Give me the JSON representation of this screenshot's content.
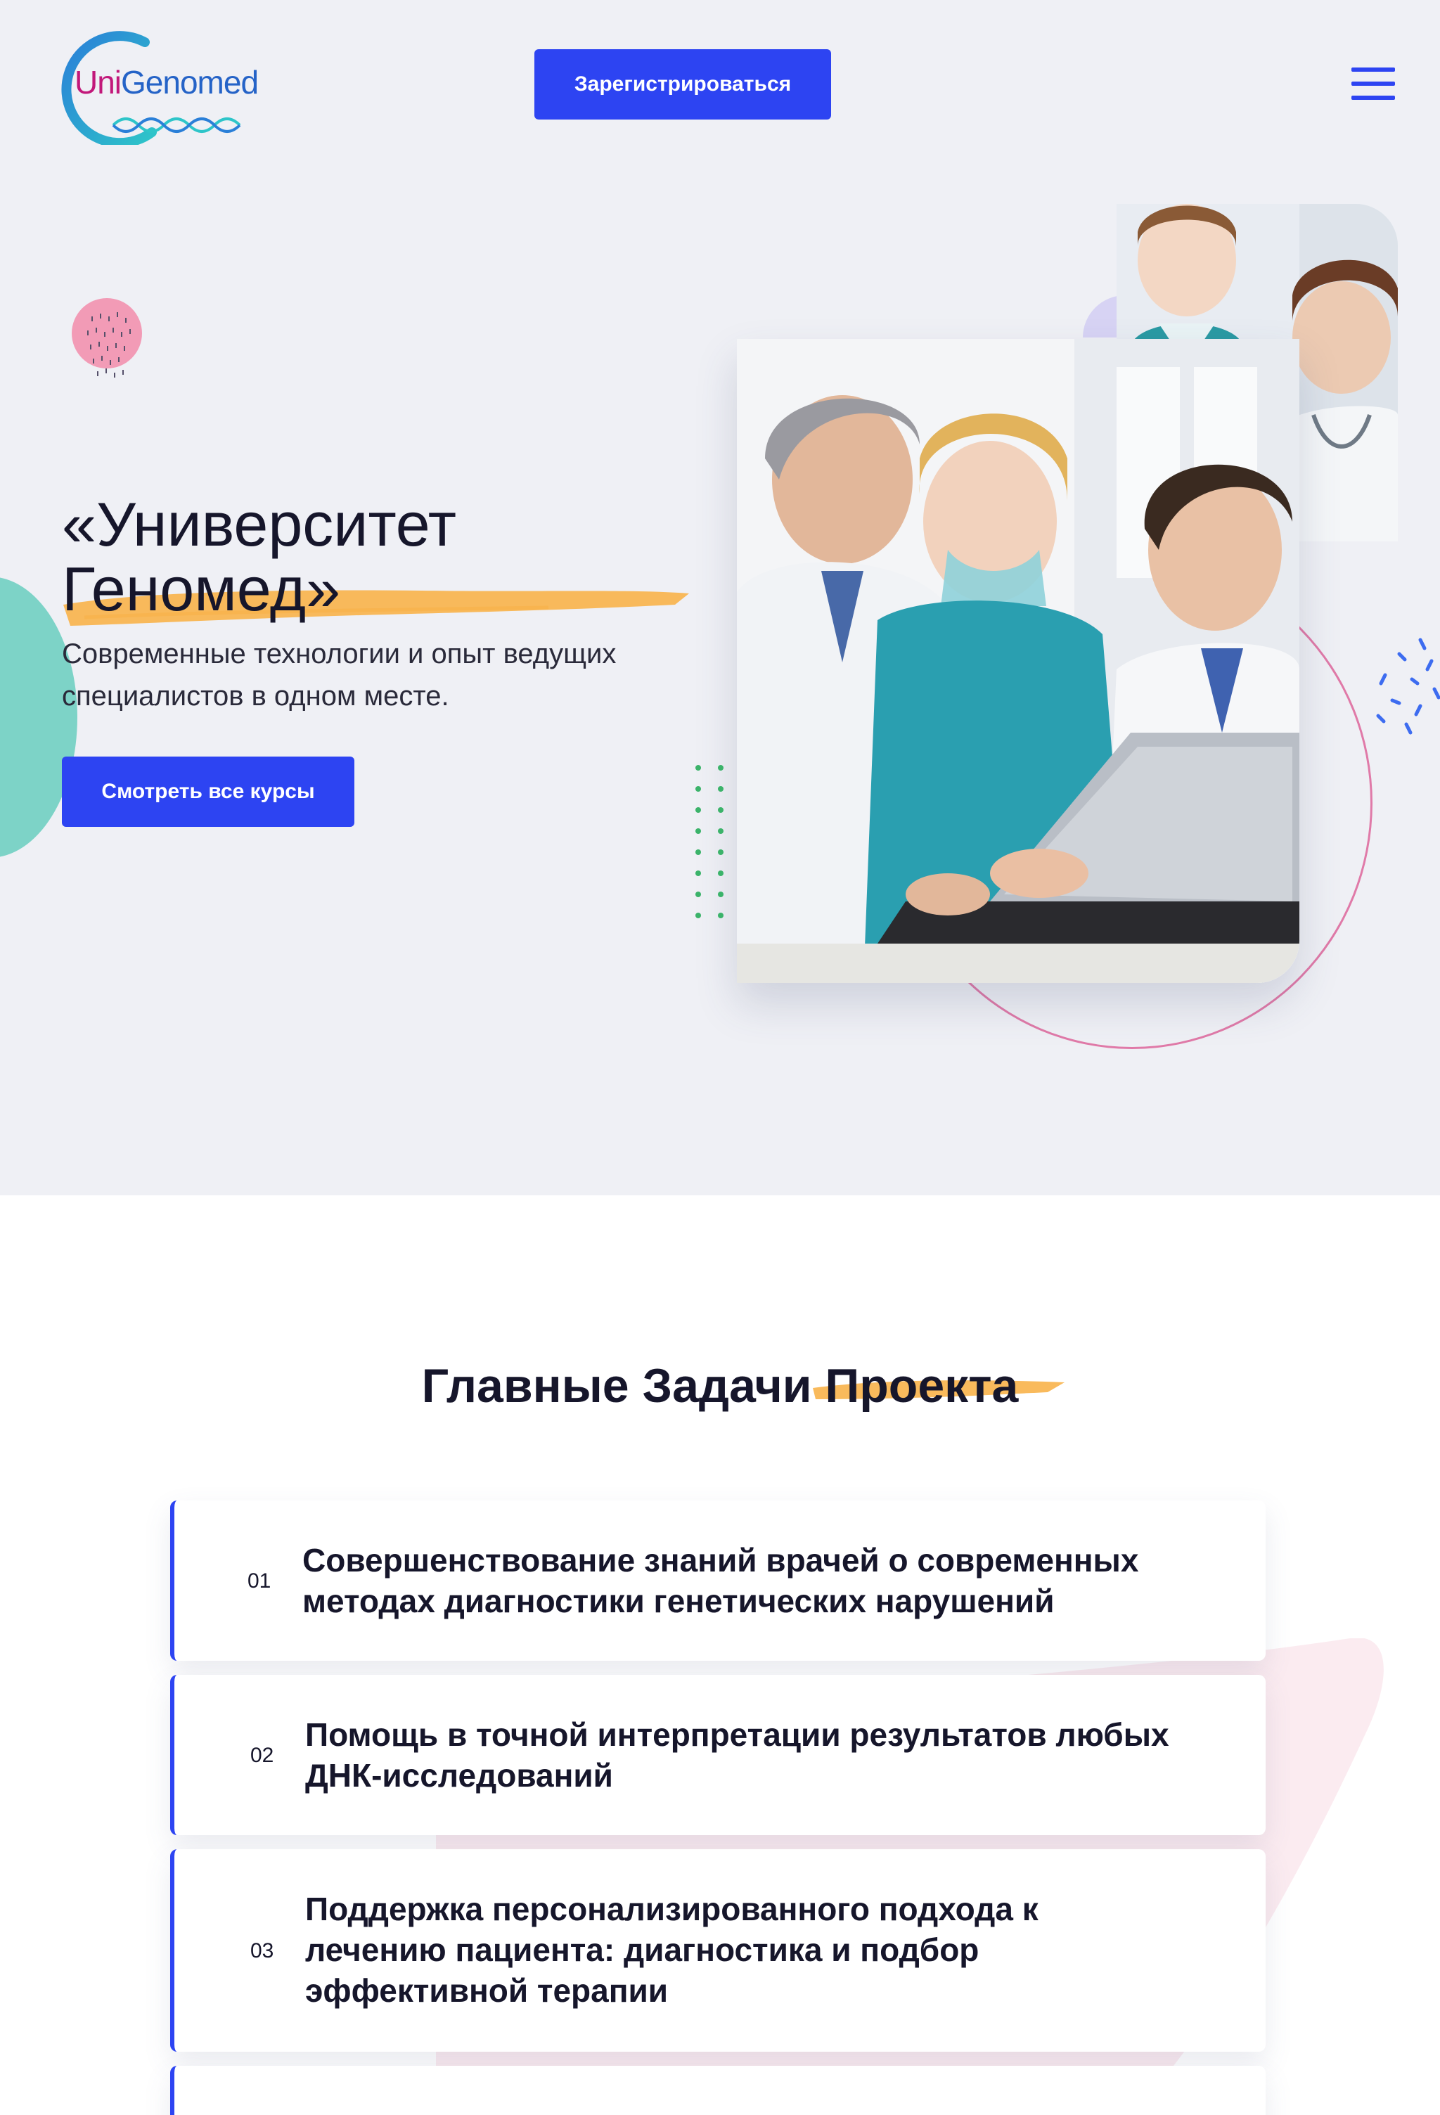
{
  "header": {
    "logo_text_uni": "Uni",
    "logo_text_genomed": "Genomed",
    "register_label": "Зарегистрироваться"
  },
  "hero": {
    "title_line1": "«Университет",
    "title_line2": "Геномед»",
    "subtitle": "Современные технологии и опыт ведущих специалистов в одном месте.",
    "cta_label": "Смотреть все курсы"
  },
  "tasks_section": {
    "title": "Главные Задачи Проекта",
    "items": [
      {
        "number": "01",
        "text": "Совершенствование знаний врачей о современных методах диагностики генетических нарушений"
      },
      {
        "number": "02",
        "text": "Помощь в точной интерпретации результатов любых ДНК-исследований"
      },
      {
        "number": "03",
        "text": "Поддержка персонализированного подхода к лечению пациента: диагностика и подбор эффективной терапии"
      }
    ]
  },
  "colors": {
    "accent_blue": "#2d44f2",
    "brush_orange": "#f8b24a",
    "hero_bg": "#eff0f5",
    "teal": "#7dd3c7",
    "pink": "#e07aa8"
  },
  "icons": {
    "menu": "hamburger-menu-icon"
  }
}
